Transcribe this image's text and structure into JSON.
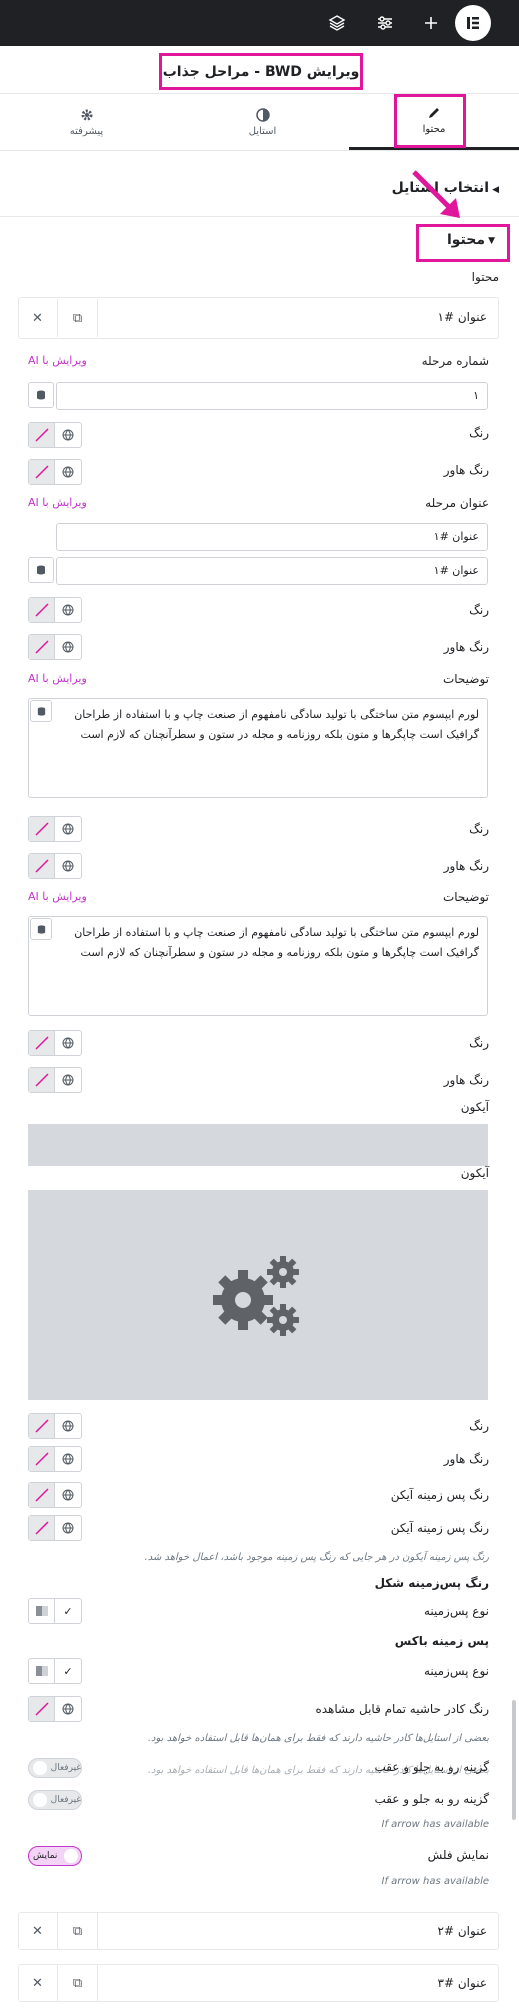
{
  "header": {
    "title": "ویرایش BWD - مراحل جذاب"
  },
  "tabs": [
    {
      "label": "محتوا"
    },
    {
      "label": "استایل"
    },
    {
      "label": "پیشرفته"
    }
  ],
  "sections": {
    "style_picker": "انتخاب استایل",
    "content": "محتوا",
    "content_sub": "محتوا"
  },
  "items": {
    "item1": "عنوان #۱",
    "item2": "عنوان #۲",
    "item3": "عنوان #۳"
  },
  "fields": {
    "step_number": "شماره مرحله",
    "step_number_value": "۱",
    "color": "رنگ",
    "hover_color": "رنگ هاور",
    "step_title": "عنوان مرحله",
    "step_title_value": "عنوان #۱",
    "step_title_value2": "عنوان #۱",
    "description": "توضیحات",
    "description_value": "لورم ایپسوم متن ساختگی با تولید سادگی نامفهوم از صنعت چاپ و با استفاده از طراحان گرافیک است چاپگرها و متون بلکه روزنامه و مجله در ستون و سطرآنچنان که لازم است",
    "icon": "آیکون",
    "icon2": "آیکون",
    "icon_bg_color": "رنگ پس زمینه آیکن",
    "icon_bg_color2": "رنگ پس زمینه آیکن",
    "icon_bg_note": "رنگ پس زمینه آیکون در هر جایی که رنگ پس زمینه موجود باشد، اعمال خواهد شد.",
    "shape_bg": "رنگ پس‌زمینه شکل",
    "bg_type": "نوع پس‌زمینه",
    "box_bg": "پس زمینه باکس",
    "bg_type2": "نوع پس‌زمینه",
    "border_color": "رنگ کادر حاشیه تمام قابل مشاهده",
    "border_note": "بعضی از استایل‌ها کادر حاشیه دارند که فقط برای همان‌ها قابل استفاده خواهد بود.",
    "border_note2": "بعضی از استایل‌ها کادر حاشیه دارند که فقط برای همان‌ها قابل استفاده خواهد بود.",
    "front_back": "گزینه رو به جلو و عقب",
    "front_back2": "گزینه رو به جلو و عقب",
    "toggle_off": "غیرفعال",
    "toggle_off2": "غیرفعال",
    "arrow_note": "If arrow has available",
    "show_arrow": "نمایش فلش",
    "toggle_on": "نمایش",
    "arrow_note2": "If arrow has available"
  },
  "ai_label": "ویرایش با AI",
  "colors": {
    "accent": "#e0169b",
    "ai": "#c036c8",
    "dark": "#1f2124"
  }
}
